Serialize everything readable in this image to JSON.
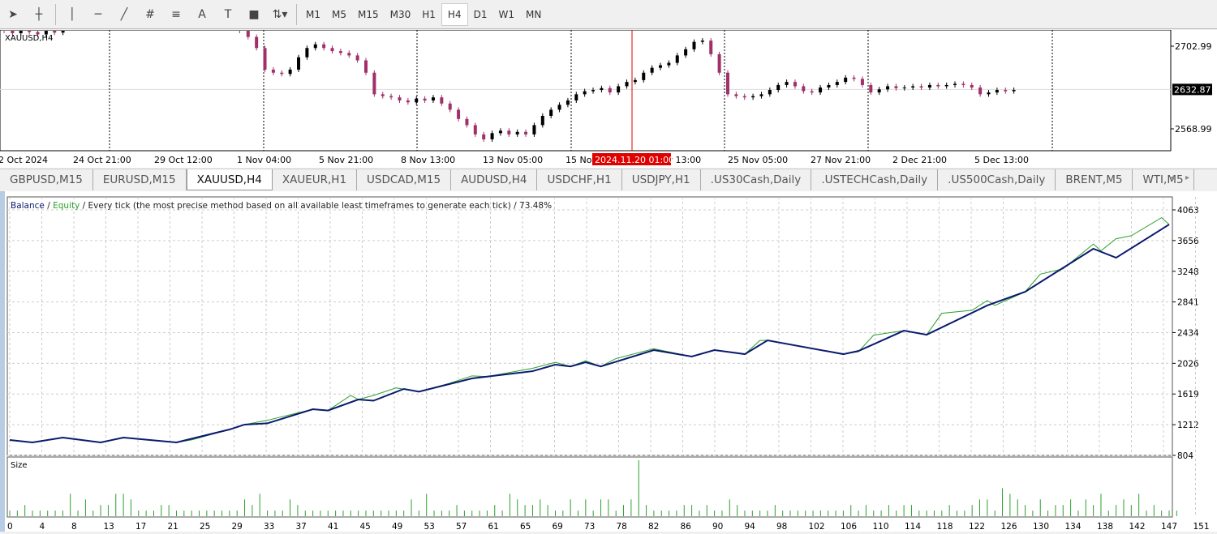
{
  "toolbar": {
    "tools": [
      "cursor-icon",
      "crosshair-icon",
      "vertical-line-icon",
      "horizontal-line-icon",
      "trendline-icon",
      "fibonacci-icon",
      "fibo-levels-icon",
      "text-icon",
      "text-label-icon",
      "rectangle-icon",
      "arrows-icon"
    ],
    "timeframes": [
      "M1",
      "M5",
      "M15",
      "M30",
      "H1",
      "H4",
      "D1",
      "W1",
      "MN"
    ],
    "active_timeframe": "H4",
    "text_tool": "A",
    "label_tool": "T"
  },
  "price_chart": {
    "symbol": "XAUUSD,H4",
    "price_labels": [
      "2702.99",
      "2568.99"
    ],
    "price_label_values": [
      2702.99,
      2568.99
    ],
    "current_price": "2632.87",
    "current_price_value": 2632.87,
    "time_labels": [
      "2 Oct 2024",
      "24 Oct 21:00",
      "29 Oct 12:00",
      "1 Nov 04:00",
      "5 Nov 21:00",
      "8 Nov 13:00",
      "13 Nov 05:00",
      "15 Nov",
      "22 Nov 13:00",
      "25 Nov 05:00",
      "27 Nov 21:00",
      "2 Dec 21:00",
      "5 Dec 13:00"
    ],
    "cursor_time": "2024.11.20 01:00",
    "bull_color": "#000000",
    "bear_color": "#a0306a",
    "cursor_color": "#e00000",
    "closes": [
      2728,
      2724,
      2730,
      2726,
      2722,
      2728,
      2725,
      2732,
      2738,
      2745,
      2752,
      2748,
      2756,
      2762,
      2758,
      2766,
      2771,
      2768,
      2775,
      2779,
      2772,
      2765,
      2770,
      2762,
      2755,
      2748,
      2740,
      2735,
      2728,
      2718,
      2700,
      2665,
      2660,
      2658,
      2665,
      2685,
      2700,
      2706,
      2700,
      2695,
      2692,
      2688,
      2680,
      2660,
      2625,
      2622,
      2620,
      2615,
      2612,
      2618,
      2615,
      2620,
      2610,
      2600,
      2585,
      2575,
      2560,
      2552,
      2562,
      2566,
      2560,
      2564,
      2560,
      2575,
      2590,
      2600,
      2608,
      2615,
      2625,
      2630,
      2632,
      2635,
      2628,
      2638,
      2645,
      2648,
      2660,
      2668,
      2672,
      2676,
      2688,
      2698,
      2710,
      2712,
      2690,
      2660,
      2625,
      2622,
      2620,
      2622,
      2625,
      2632,
      2640,
      2645,
      2638,
      2630,
      2628,
      2636,
      2640,
      2645,
      2652,
      2650,
      2640,
      2628,
      2633,
      2638,
      2635,
      2636,
      2638,
      2636,
      2640,
      2638,
      2640,
      2642,
      2640,
      2636,
      2625,
      2628,
      2632,
      2630,
      2632
    ]
  },
  "tabs": [
    {
      "label": "GBPUSD,M15"
    },
    {
      "label": "EURUSD,M15"
    },
    {
      "label": "XAUUSD,H4",
      "active": true
    },
    {
      "label": "XAUEUR,H1"
    },
    {
      "label": "USDCAD,M15"
    },
    {
      "label": "AUDUSD,H4"
    },
    {
      "label": "USDCHF,H1"
    },
    {
      "label": "USDJPY,H1"
    },
    {
      "label": ".US30Cash,Daily"
    },
    {
      "label": ".USTECHCash,Daily"
    },
    {
      "label": ".US500Cash,Daily"
    },
    {
      "label": "BRENT,M5"
    },
    {
      "label": "WTI,M5"
    }
  ],
  "chart_data": {
    "type": "line",
    "title_balance": "Balance",
    "title_sep": " / ",
    "title_equity": "Equity",
    "title_rest": " / Every tick (the most precise method based on all available least timeframes to generate each tick) / 73.48%",
    "ylim": [
      804,
      4063
    ],
    "yticks": [
      4063,
      3656,
      3248,
      2841,
      2434,
      2026,
      1619,
      1212,
      804
    ],
    "xlim": [
      0,
      153
    ],
    "xticks": [
      0,
      4,
      8,
      13,
      17,
      21,
      25,
      29,
      33,
      37,
      41,
      45,
      49,
      53,
      57,
      61,
      65,
      69,
      73,
      78,
      82,
      86,
      90,
      94,
      98,
      102,
      106,
      110,
      114,
      118,
      122,
      126,
      130,
      134,
      138,
      142,
      147,
      151
    ],
    "grid": true,
    "series": [
      {
        "name": "Balance",
        "color": "#0a1a6e",
        "x": [
          0,
          3,
          7,
          12,
          15,
          22,
          29,
          31,
          34,
          40,
          42,
          46,
          48,
          52,
          54,
          61,
          63,
          69,
          72,
          74,
          76,
          78,
          85,
          90,
          93,
          97,
          100,
          110,
          112,
          118,
          121,
          129,
          134,
          143,
          146,
          153
        ],
        "y": [
          1008,
          976,
          1040,
          976,
          1040,
          976,
          1148,
          1213,
          1230,
          1417,
          1400,
          1546,
          1530,
          1686,
          1650,
          1826,
          1850,
          1922,
          2008,
          1985,
          2041,
          1985,
          2202,
          2116,
          2202,
          2148,
          2331,
          2148,
          2190,
          2460,
          2406,
          2794,
          2976,
          3547,
          3428,
          3869
        ]
      },
      {
        "name": "Equity",
        "color": "#2ca02c",
        "x": [
          0,
          3,
          7,
          12,
          15,
          22,
          24,
          29,
          31,
          34,
          40,
          42,
          45,
          46,
          48,
          51,
          54,
          58,
          61,
          63,
          69,
          72,
          74,
          76,
          78,
          80,
          85,
          90,
          93,
          97,
          99,
          100,
          110,
          112,
          114,
          118,
          121,
          123,
          127,
          129,
          130,
          134,
          136,
          139,
          143,
          144,
          146,
          148,
          152,
          153
        ],
        "y": [
          1008,
          976,
          1040,
          976,
          1040,
          976,
          1010,
          1148,
          1213,
          1270,
          1417,
          1400,
          1600,
          1546,
          1600,
          1700,
          1650,
          1760,
          1860,
          1850,
          1960,
          2040,
          1985,
          2060,
          1985,
          2090,
          2220,
          2116,
          2202,
          2148,
          2330,
          2331,
          2148,
          2180,
          2400,
          2460,
          2406,
          2690,
          2730,
          2860,
          2794,
          2976,
          3210,
          3280,
          3610,
          3520,
          3680,
          3720,
          3960,
          3869
        ]
      }
    ],
    "size_panel": {
      "label": "Size",
      "color": "#2ca02c",
      "values": [
        1,
        1,
        2,
        1,
        1,
        1,
        1,
        1,
        4,
        1,
        3,
        1,
        2,
        2,
        4,
        4,
        3,
        1,
        1,
        1,
        2,
        2,
        1,
        1,
        1,
        1,
        1,
        1,
        1,
        1,
        1,
        3,
        2,
        4,
        1,
        1,
        1,
        3,
        2,
        1,
        1,
        1,
        1,
        1,
        1,
        1,
        1,
        1,
        1,
        1,
        1,
        1,
        1,
        3,
        1,
        4,
        1,
        1,
        1,
        2,
        1,
        1,
        1,
        1,
        2,
        1,
        4,
        3,
        2,
        2,
        3,
        2,
        1,
        1,
        3,
        1,
        3,
        1,
        3,
        3,
        1,
        2,
        3,
        10,
        2,
        1,
        1,
        1,
        1,
        2,
        2,
        1,
        2,
        1,
        1,
        3,
        2,
        1,
        1,
        1,
        1,
        2,
        1,
        1,
        1,
        1,
        1,
        1,
        1,
        1,
        1,
        2,
        1,
        2,
        1,
        1,
        2,
        1,
        2,
        2,
        1,
        1,
        1,
        1,
        2,
        1,
        1,
        2,
        3,
        3,
        1,
        5,
        4,
        3,
        2,
        1,
        3,
        1,
        2,
        2,
        3,
        1,
        3,
        2,
        4,
        1,
        2,
        3,
        2,
        4,
        1,
        2,
        1,
        1,
        1
      ]
    }
  }
}
